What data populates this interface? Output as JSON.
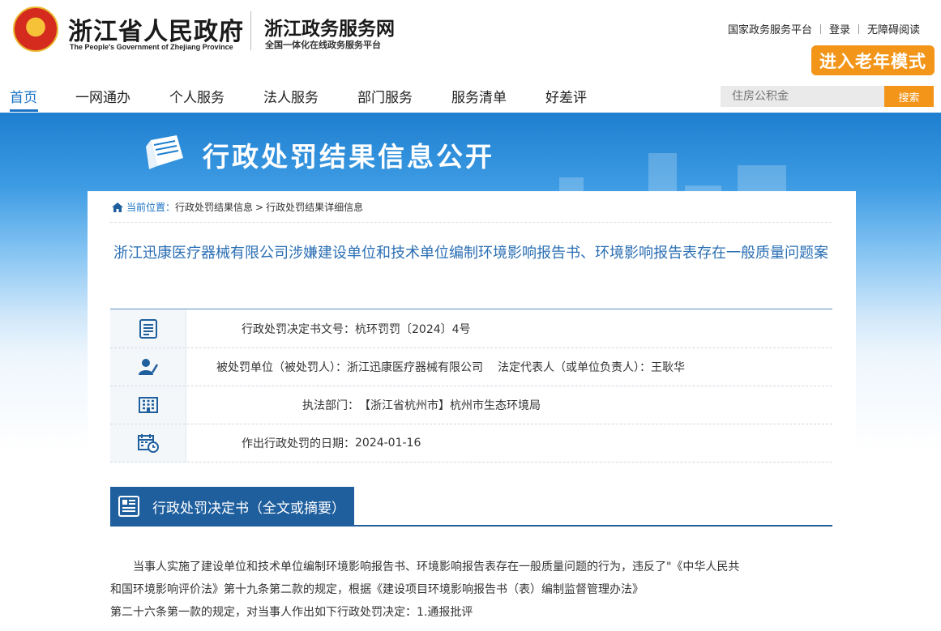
{
  "header": {
    "gov_name_cn": "浙江省人民政府",
    "gov_name_en": "The People's Government of Zhejiang Province",
    "service_title": "浙江政务服务网",
    "service_subtitle": "全国一体化在线政务服务平台",
    "top_links": [
      "国家政务服务平台",
      "登录",
      "无障碍阅读"
    ],
    "elder_mode_label": "进入老年模式"
  },
  "nav": {
    "items": [
      "首页",
      "一网通办",
      "个人服务",
      "法人服务",
      "部门服务",
      "服务清单",
      "好差评"
    ],
    "active_index": 0,
    "search_placeholder": "住房公积金",
    "search_button": "搜索"
  },
  "banner": {
    "title": "行政处罚结果信息公开"
  },
  "breadcrumb": {
    "label": "当前位置：",
    "items": [
      "行政处罚结果信息",
      "行政处罚结果详细信息"
    ],
    "separator": ">"
  },
  "case": {
    "title": "浙江迅康医疗器械有限公司涉嫌建设单位和技术单位编制环境影响报告书、环境影响报告表存在一般质量问题案",
    "decision_no_label": "行政处罚决定书文号：",
    "decision_no": "杭环罚罚〔2024〕4号",
    "party_label": "被处罚单位（被处罚人）：",
    "party": "浙江迅康医疗器械有限公司",
    "rep_label": "法定代表人（或单位负责人）：",
    "rep": "王耿华",
    "dept_label": "执法部门：",
    "dept": "【浙江省杭州市】杭州市生态环境局",
    "date_label": "作出行政处罚的日期：",
    "date": "2024-01-16"
  },
  "document": {
    "section_title": "行政处罚决定书（全文或摘要）",
    "line1": "当事人实施了建设单位和技术单位编制环境影响报告书、环境影响报告表存在一般质量问题的行为，违反了\"《中华人民共",
    "line2": "和国环境影响评价法》第十九条第二款的规定，根据《建设项目环境影响报告书（表）编制监督管理办法》",
    "line3": "第二十六条第一款的规定，对当事人作出如下行政处罚决定：1.通报批评"
  },
  "colors": {
    "brand_blue": "#1a73c4",
    "title_blue": "#2b6fb4",
    "section_blue": "#1f5f9e",
    "accent_orange": "#f29519"
  }
}
